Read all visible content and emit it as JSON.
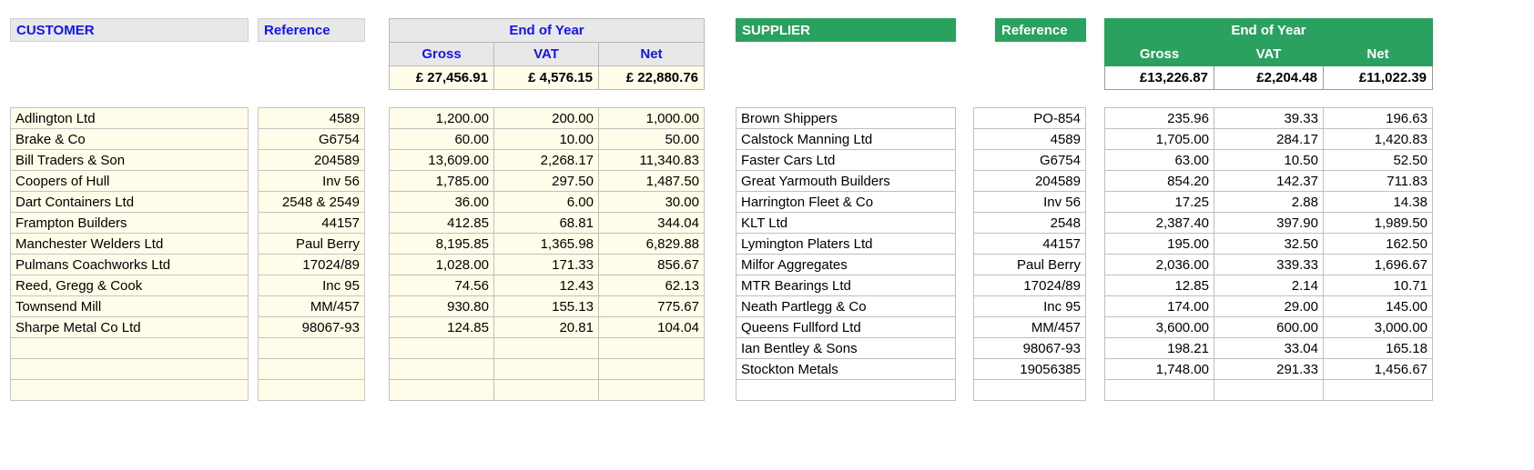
{
  "customer": {
    "title": "CUSTOMER",
    "reference_label": "Reference",
    "end_of_year": {
      "group_label": "End of Year",
      "columns": [
        "Gross",
        "VAT",
        "Net"
      ],
      "totals": [
        "£ 27,456.91",
        "£  4,576.15",
        "£ 22,880.76"
      ]
    },
    "accent_color": "#1414f0",
    "header_bg": "#e8e8e8",
    "row_bg": "#fffce9",
    "rows": [
      {
        "name": "Adlington Ltd",
        "reference": "4589",
        "gross": "1,200.00",
        "vat": "200.00",
        "net": "1,000.00"
      },
      {
        "name": "Brake & Co",
        "reference": "G6754",
        "gross": "60.00",
        "vat": "10.00",
        "net": "50.00"
      },
      {
        "name": "Bill Traders & Son",
        "reference": "204589",
        "gross": "13,609.00",
        "vat": "2,268.17",
        "net": "11,340.83"
      },
      {
        "name": "Coopers of Hull",
        "reference": "Inv 56",
        "gross": "1,785.00",
        "vat": "297.50",
        "net": "1,487.50"
      },
      {
        "name": "Dart Containers Ltd",
        "reference": "2548 & 2549",
        "gross": "36.00",
        "vat": "6.00",
        "net": "30.00"
      },
      {
        "name": "Frampton Builders",
        "reference": "44157",
        "gross": "412.85",
        "vat": "68.81",
        "net": "344.04"
      },
      {
        "name": "Manchester Welders Ltd",
        "reference": "Paul Berry",
        "gross": "8,195.85",
        "vat": "1,365.98",
        "net": "6,829.88"
      },
      {
        "name": "Pulmans Coachworks Ltd",
        "reference": "17024/89",
        "gross": "1,028.00",
        "vat": "171.33",
        "net": "856.67"
      },
      {
        "name": "Reed, Gregg & Cook",
        "reference": "Inc 95",
        "gross": "74.56",
        "vat": "12.43",
        "net": "62.13"
      },
      {
        "name": "Townsend Mill",
        "reference": "MM/457",
        "gross": "930.80",
        "vat": "155.13",
        "net": "775.67"
      },
      {
        "name": "Sharpe Metal Co Ltd",
        "reference": "98067-93",
        "gross": "124.85",
        "vat": "20.81",
        "net": "104.04"
      },
      {
        "name": "",
        "reference": "",
        "gross": "",
        "vat": "",
        "net": ""
      },
      {
        "name": "",
        "reference": "",
        "gross": "",
        "vat": "",
        "net": ""
      },
      {
        "name": "",
        "reference": "",
        "gross": "",
        "vat": "",
        "net": ""
      }
    ]
  },
  "supplier": {
    "title": "SUPPLIER",
    "reference_label": "Reference",
    "end_of_year": {
      "group_label": "End of Year",
      "columns": [
        "Gross",
        "VAT",
        "Net"
      ],
      "totals": [
        "£13,226.87",
        "£2,204.48",
        "£11,022.39"
      ]
    },
    "accent_color": "#2ba15f",
    "header_bg": "#2ba15f",
    "row_bg": "#ffffff",
    "rows": [
      {
        "name": "Brown Shippers",
        "reference": "PO-854",
        "gross": "235.96",
        "vat": "39.33",
        "net": "196.63"
      },
      {
        "name": "Calstock Manning Ltd",
        "reference": "4589",
        "gross": "1,705.00",
        "vat": "284.17",
        "net": "1,420.83"
      },
      {
        "name": "Faster Cars Ltd",
        "reference": "G6754",
        "gross": "63.00",
        "vat": "10.50",
        "net": "52.50"
      },
      {
        "name": "Great Yarmouth Builders",
        "reference": "204589",
        "gross": "854.20",
        "vat": "142.37",
        "net": "711.83"
      },
      {
        "name": "Harrington Fleet & Co",
        "reference": "Inv 56",
        "gross": "17.25",
        "vat": "2.88",
        "net": "14.38"
      },
      {
        "name": "KLT Ltd",
        "reference": "2548",
        "gross": "2,387.40",
        "vat": "397.90",
        "net": "1,989.50"
      },
      {
        "name": "Lymington Platers Ltd",
        "reference": "44157",
        "gross": "195.00",
        "vat": "32.50",
        "net": "162.50"
      },
      {
        "name": "Milfor Aggregates",
        "reference": "Paul Berry",
        "gross": "2,036.00",
        "vat": "339.33",
        "net": "1,696.67"
      },
      {
        "name": "MTR Bearings Ltd",
        "reference": "17024/89",
        "gross": "12.85",
        "vat": "2.14",
        "net": "10.71"
      },
      {
        "name": "Neath Partlegg & Co",
        "reference": "Inc 95",
        "gross": "174.00",
        "vat": "29.00",
        "net": "145.00"
      },
      {
        "name": "Queens Fullford Ltd",
        "reference": "MM/457",
        "gross": "3,600.00",
        "vat": "600.00",
        "net": "3,000.00"
      },
      {
        "name": "Ian Bentley & Sons",
        "reference": "98067-93",
        "gross": "198.21",
        "vat": "33.04",
        "net": "165.18"
      },
      {
        "name": "Stockton Metals",
        "reference": "19056385",
        "gross": "1,748.00",
        "vat": "291.33",
        "net": "1,456.67"
      },
      {
        "name": "",
        "reference": "",
        "gross": "",
        "vat": "",
        "net": ""
      }
    ]
  }
}
